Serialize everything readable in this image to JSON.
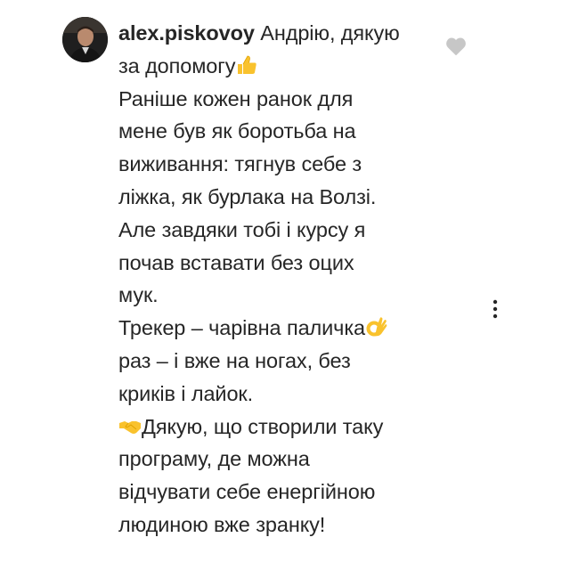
{
  "comment": {
    "username": "alex.piskovoy",
    "lines": [
      " Андрію, дякую",
      "за допомогу",
      "Раніше кожен ранок для",
      "мене був як боротьба на",
      "виживання: тягнув себе з",
      "ліжка, як бурлака на Волзі.",
      "Але завдяки тобі і курсу я",
      "почав вставати без оцих",
      "мук.",
      "Трекер – чарівна паличка",
      "раз – і вже на ногах, без",
      "криків і лайок.",
      "Дякую, що створили таку",
      "програму, де можна",
      "відчувати себе енергійною",
      "людиною вже зранку!"
    ],
    "emojis": {
      "thumbs_up": "thumbs-up-emoji",
      "ok_hand": "ok-hand-emoji",
      "handshake": "handshake-emoji"
    }
  },
  "icons": {
    "like": "heart-icon",
    "more": "more-vertical-icon"
  },
  "colors": {
    "text": "#262626",
    "heart_outline": "#c7c7c7",
    "more_icon": "#262626",
    "emoji_yellow": "#f9c22d"
  }
}
